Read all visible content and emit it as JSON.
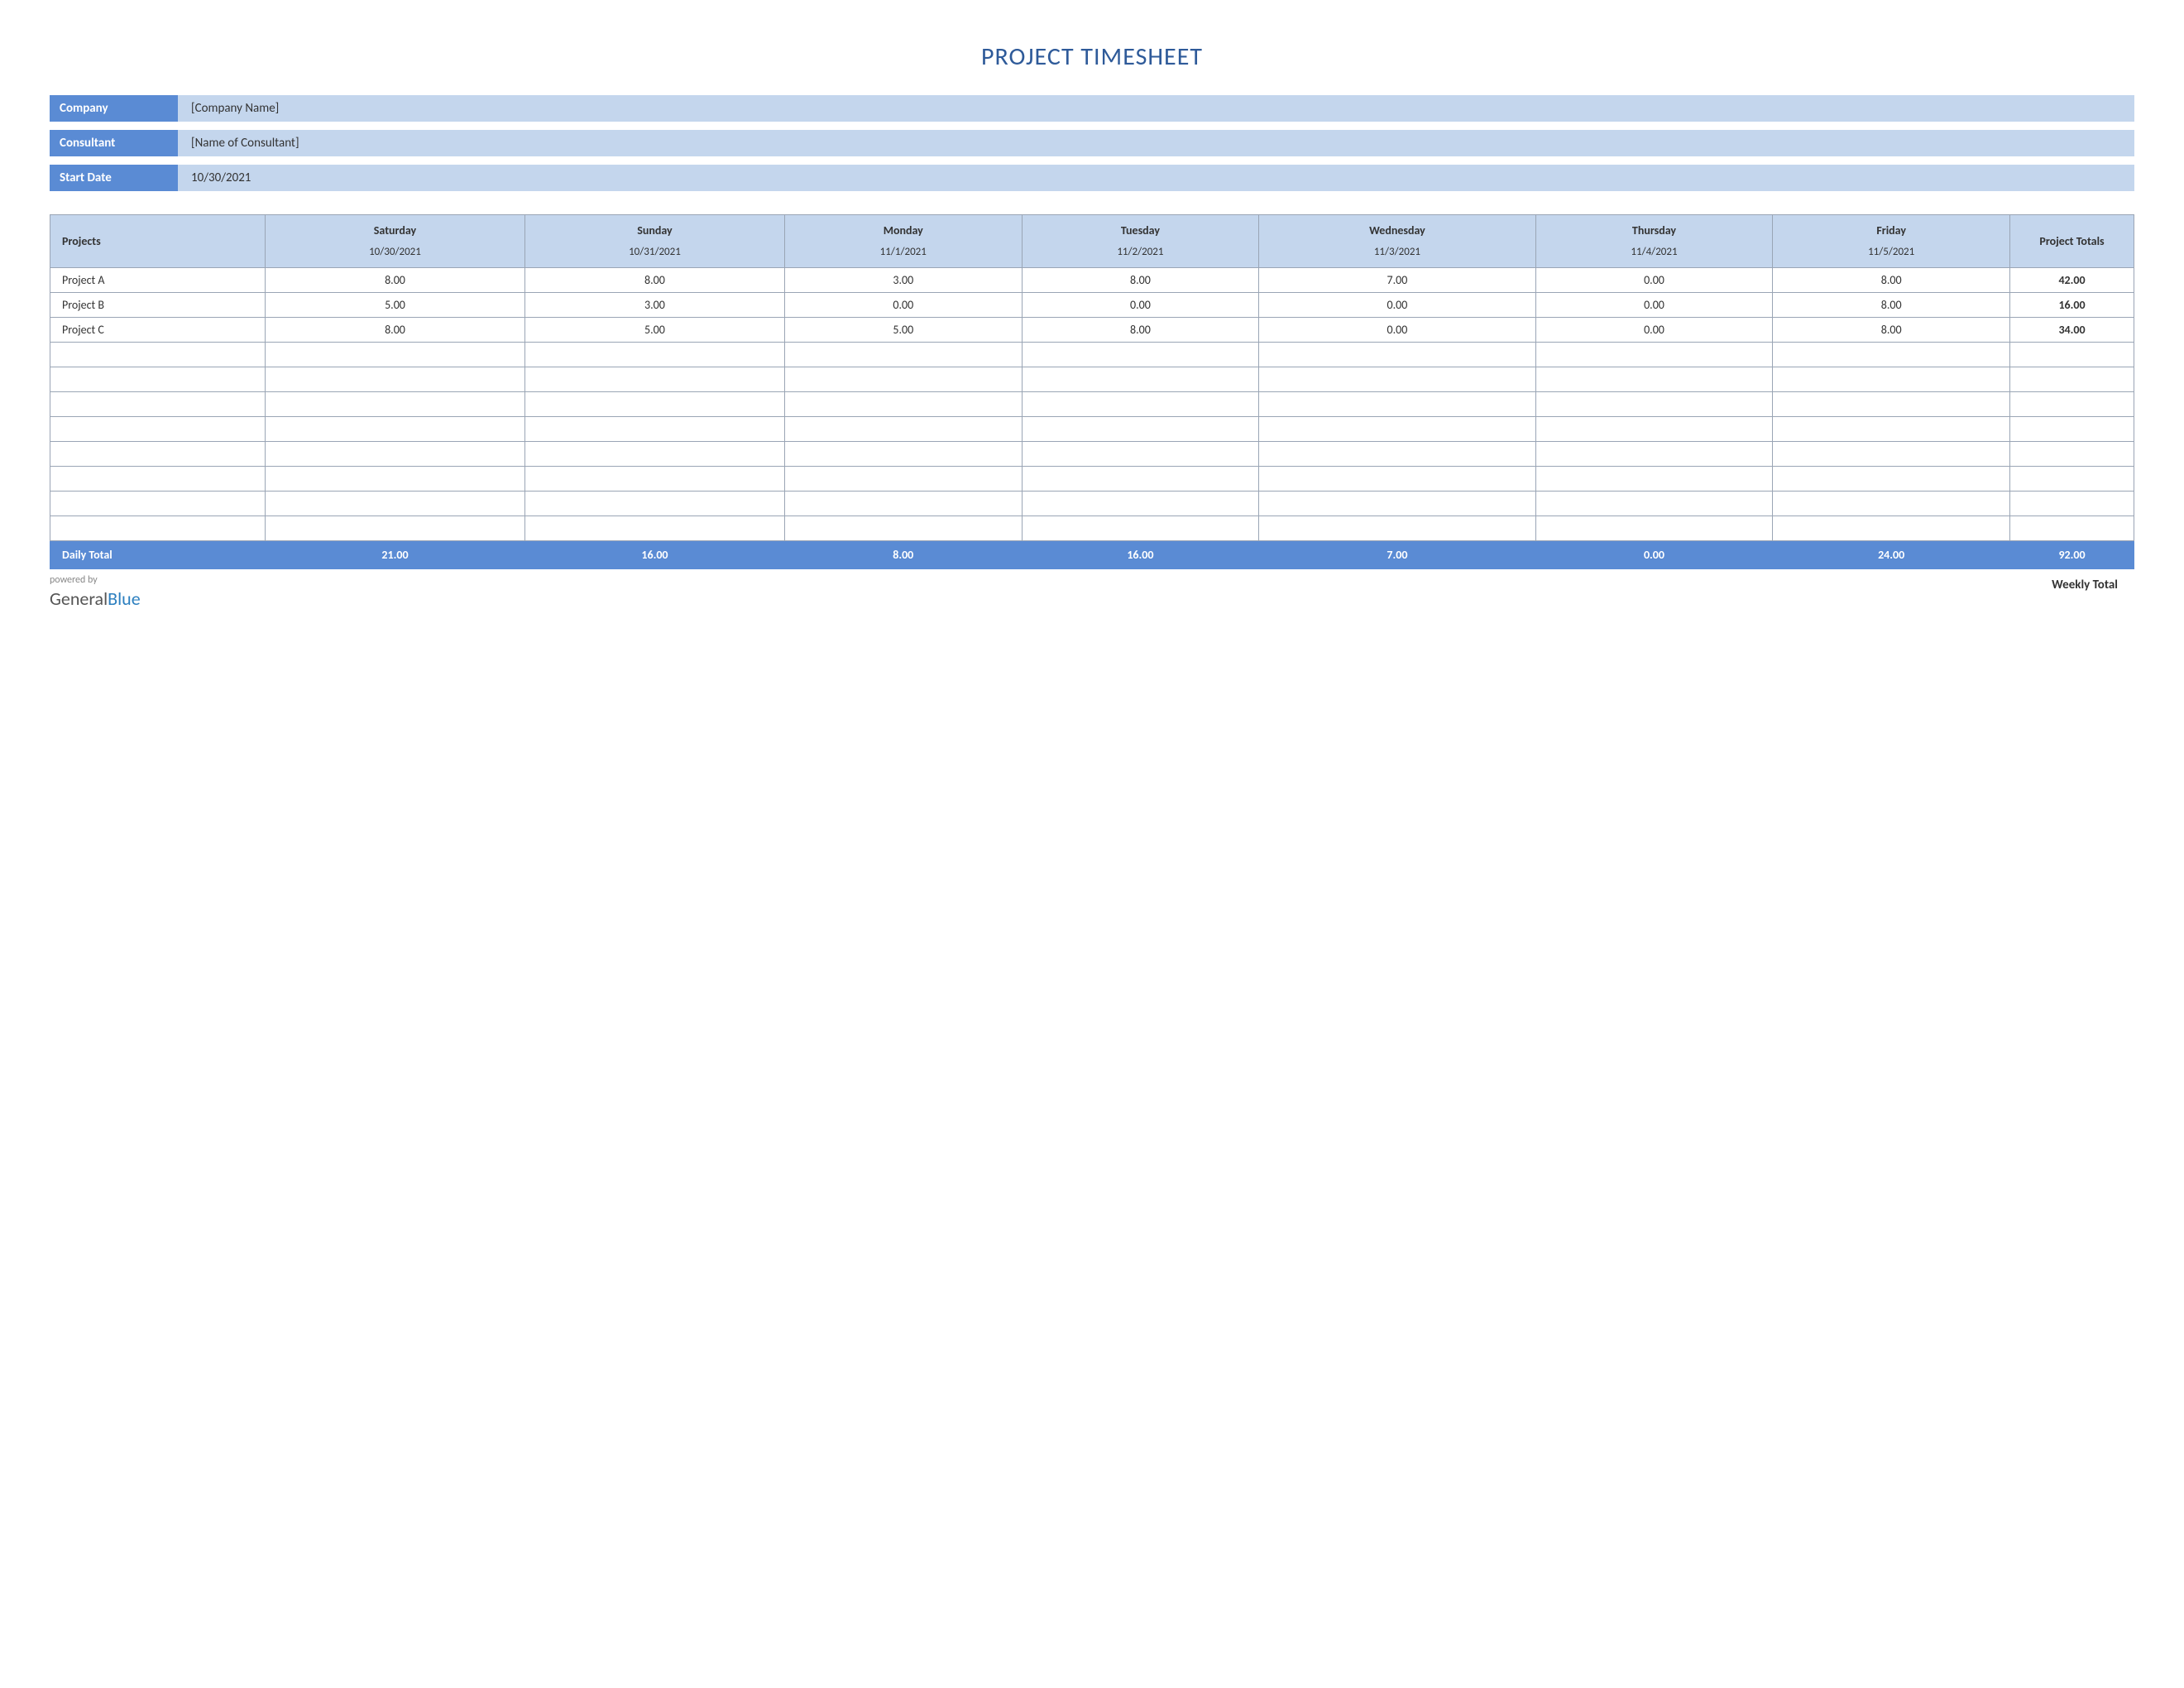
{
  "title": "PROJECT TIMESHEET",
  "info": {
    "company_label": "Company",
    "company_value": "[Company Name]",
    "consultant_label": "Consultant",
    "consultant_value": "[Name of Consultant]",
    "startdate_label": "Start Date",
    "startdate_value": "10/30/2021"
  },
  "headers": {
    "projects": "Projects",
    "totals": "Project Totals",
    "days": [
      {
        "name": "Saturday",
        "date": "10/30/2021"
      },
      {
        "name": "Sunday",
        "date": "10/31/2021"
      },
      {
        "name": "Monday",
        "date": "11/1/2021"
      },
      {
        "name": "Tuesday",
        "date": "11/2/2021"
      },
      {
        "name": "Wednesday",
        "date": "11/3/2021"
      },
      {
        "name": "Thursday",
        "date": "11/4/2021"
      },
      {
        "name": "Friday",
        "date": "11/5/2021"
      }
    ]
  },
  "rows": [
    {
      "name": "Project A",
      "vals": [
        "8.00",
        "8.00",
        "3.00",
        "8.00",
        "7.00",
        "0.00",
        "8.00"
      ],
      "total": "42.00"
    },
    {
      "name": "Project B",
      "vals": [
        "5.00",
        "3.00",
        "0.00",
        "0.00",
        "0.00",
        "0.00",
        "8.00"
      ],
      "total": "16.00"
    },
    {
      "name": "Project C",
      "vals": [
        "8.00",
        "5.00",
        "5.00",
        "8.00",
        "0.00",
        "0.00",
        "8.00"
      ],
      "total": "34.00"
    }
  ],
  "empty_rows": 8,
  "daily": {
    "label": "Daily Total",
    "vals": [
      "21.00",
      "16.00",
      "8.00",
      "16.00",
      "7.00",
      "0.00",
      "24.00"
    ],
    "weekly": "92.00"
  },
  "footer": {
    "powered": "powered by",
    "logo1": "General",
    "logo2": "Blue",
    "weekly_label": "Weekly Total"
  }
}
